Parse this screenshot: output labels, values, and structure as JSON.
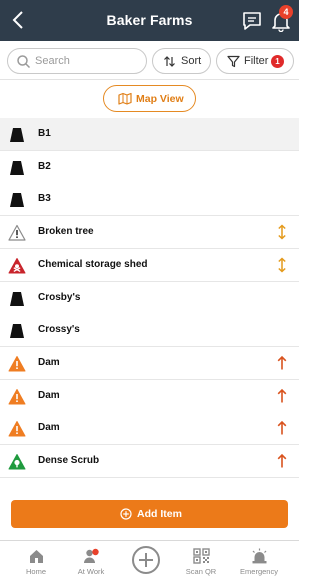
{
  "header": {
    "title": "Baker Farms",
    "notification_count": "4",
    "back_icon": "chevron-left-icon",
    "chat_icon": "chat-icon",
    "bell_icon": "bell-icon"
  },
  "toolbar": {
    "search_placeholder": "Search",
    "sort_label": "Sort",
    "filter_label": "Filter",
    "filter_count": "1"
  },
  "map_view_label": "Map View",
  "items": [
    {
      "name": "B1",
      "icon": "black-trapezoid-icon",
      "action": "",
      "selected": true
    },
    {
      "name": "B2",
      "icon": "black-trapezoid-icon",
      "action": ""
    },
    {
      "name": "B3",
      "icon": "black-trapezoid-icon",
      "action": ""
    },
    {
      "name": "Broken tree",
      "icon": "warning-outline-icon",
      "action": "updown"
    },
    {
      "name": "Chemical storage shed",
      "icon": "hazard-red-icon",
      "action": "updown"
    },
    {
      "name": "Crosby's",
      "icon": "black-trapezoid-icon",
      "action": ""
    },
    {
      "name": "Crossy's",
      "icon": "black-trapezoid-icon",
      "action": ""
    },
    {
      "name": "Dam",
      "icon": "warning-orange-icon",
      "action": "up"
    },
    {
      "name": "Dam",
      "icon": "warning-orange-icon",
      "action": "up"
    },
    {
      "name": "Dam",
      "icon": "warning-orange-icon",
      "action": "up"
    },
    {
      "name": "Dense Scrub",
      "icon": "tree-green-icon",
      "action": "up"
    }
  ],
  "add_item_label": "Add Item",
  "nav": {
    "home": "Home",
    "at_work": "At Work",
    "scan_qr": "Scan QR",
    "emergency": "Emergency"
  },
  "colors": {
    "header_bg": "#2f3d4b",
    "accent_orange": "#ec7a19",
    "badge_red": "#e8412b"
  }
}
